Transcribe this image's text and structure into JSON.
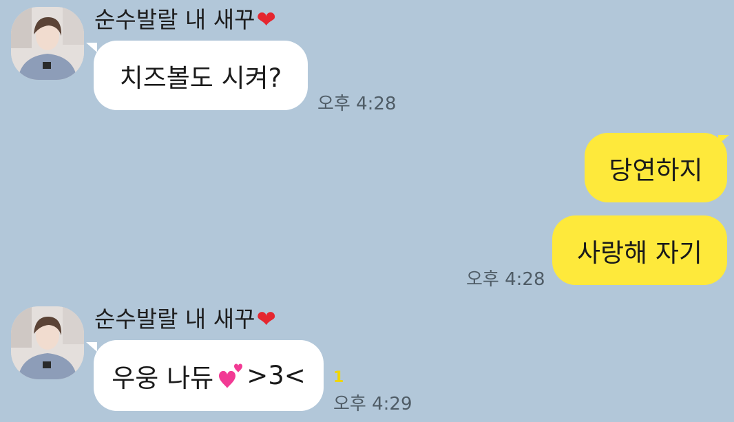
{
  "messages": [
    {
      "sender": "순수발랄 내 새꾸",
      "heart": "❤",
      "text": "치즈볼도 시켜?",
      "time": "오후 4:28"
    },
    {
      "text": "당연하지"
    },
    {
      "text": "사랑해 자기",
      "time": "오후 4:28"
    },
    {
      "sender": "순수발랄 내 새꾸",
      "heart": "❤",
      "text_before": "우웅 나듀",
      "emoji": "two-hearts",
      "text_after": ">3<",
      "unread": "1",
      "time": "오후 4:29"
    }
  ],
  "colors": {
    "background": "#b2c7d9",
    "incoming_bubble": "#ffffff",
    "outgoing_bubble": "#fee93b",
    "heart": "#e5262f",
    "unread": "#f0d600"
  }
}
